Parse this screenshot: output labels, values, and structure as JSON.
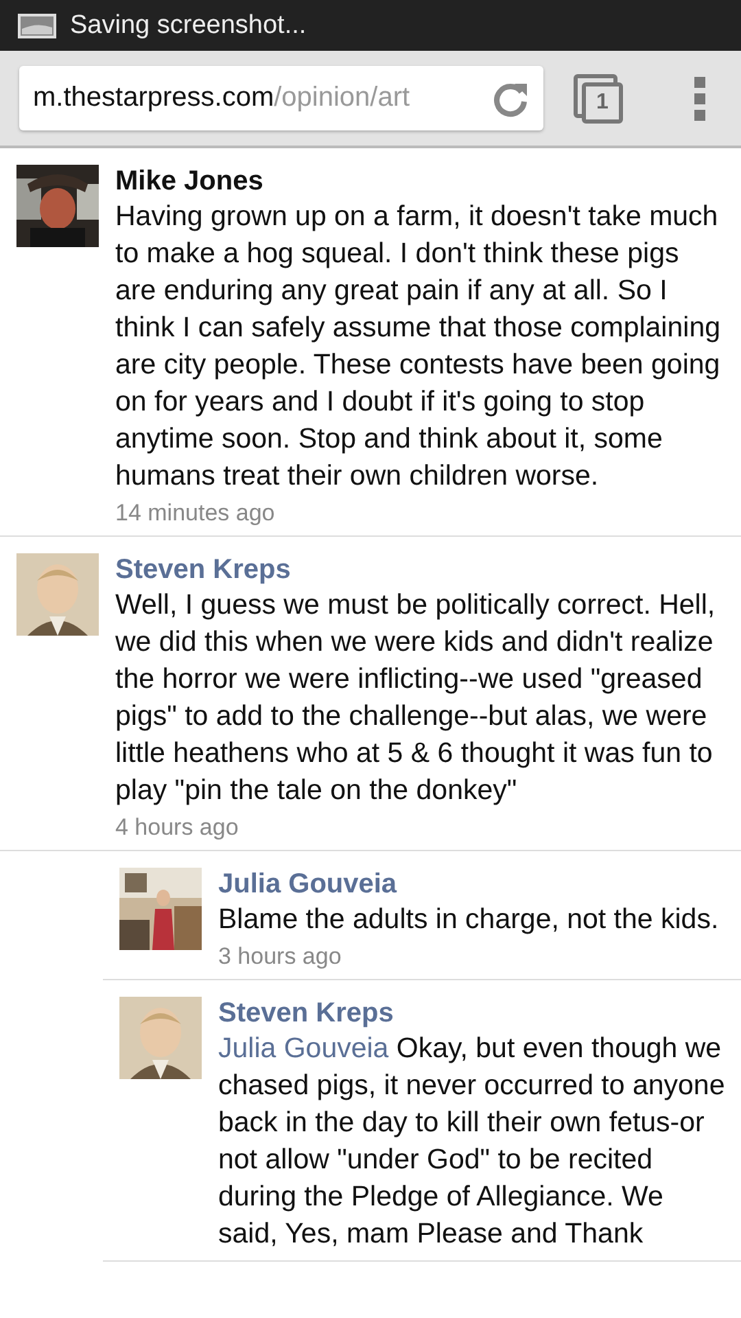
{
  "status_bar": {
    "notification": "Saving screenshot..."
  },
  "toolbar": {
    "url_host": "m.thestarpress.com",
    "url_path": "/opinion/art",
    "tab_count": "1"
  },
  "comments": [
    {
      "author": "Mike Jones",
      "author_linked": false,
      "text": "Having grown up on a farm, it doesn't take much to make a hog squeal. I don't think these pigs are enduring any great pain if any at all. So I think I can safely assume that those complaining are city people. These contests have been going on for years and I doubt if it's going to stop anytime soon. Stop and think about it, some humans treat their own children worse.",
      "time": "14 minutes ago"
    },
    {
      "author": "Steven Kreps",
      "author_linked": true,
      "text": "Well, I guess we must be politically correct. Hell, we did this when we were kids and didn't realize the horror we were inflicting--we used \"greased pigs\" to add to the challenge--but alas, we were little heathens who at 5 & 6 thought it was fun to play \"pin the tale on the donkey\"",
      "time": "4 hours ago",
      "children": [
        {
          "author": "Julia Gouveia",
          "author_linked": true,
          "text": "Blame the adults in charge, not the kids.",
          "time": "3 hours ago"
        },
        {
          "author": "Steven Kreps",
          "author_linked": true,
          "mention": "Julia Gouveia",
          "text": "Okay, but even though we chased pigs, it never occurred to anyone back in the day to kill their own fetus-or not allow \"under God\" to be recited during the Pledge of Allegiance. We said, Yes, mam Please and Thank"
        }
      ]
    }
  ]
}
